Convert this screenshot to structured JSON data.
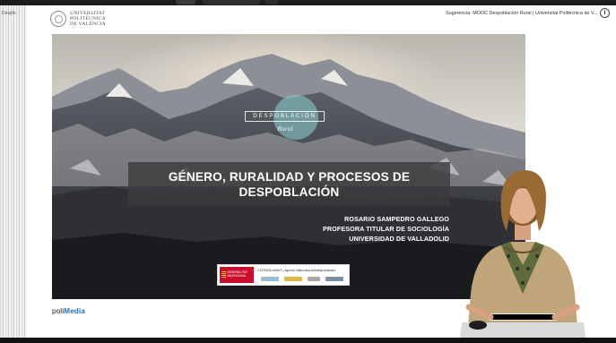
{
  "window": {
    "left_strip_label": "Desplo"
  },
  "header": {
    "logo_lines": [
      "UNIVERSITAT",
      "POLITÈCNICA",
      "DE VALÈNCIA"
    ],
    "suggestion": "Sugerencia: MOOC Despoblación Rural | Universitat Politècnica de V...",
    "info_icon": "i"
  },
  "slide": {
    "course_label": "DESPOBLACIÓN",
    "course_sublabel": "Rural",
    "title_line1": "GÉNERO, RURALIDAD Y PROCESOS DE",
    "title_line2": "DESPOBLACIÓN",
    "author_name": "ROSARIO SAMPEDRO GALLEGO",
    "author_role": "PROFESORA TITULAR DE SOCIOLOGÍA",
    "author_institution": "UNIVERSIDAD DE VALLADOLID",
    "sponsor_text": "CÀTEDRA AVANT | Agenda Valenciana Antidespoblament",
    "sponsor_gen_text": "GENERALITAT VALENCIANA"
  },
  "footer": {
    "brand_poli": "poli",
    "brand_media": "Media"
  },
  "colors": {
    "accent_red": "#c8102e",
    "polimedia_blue": "#2a6fb6",
    "deco_teal": "#8ed4d4"
  }
}
